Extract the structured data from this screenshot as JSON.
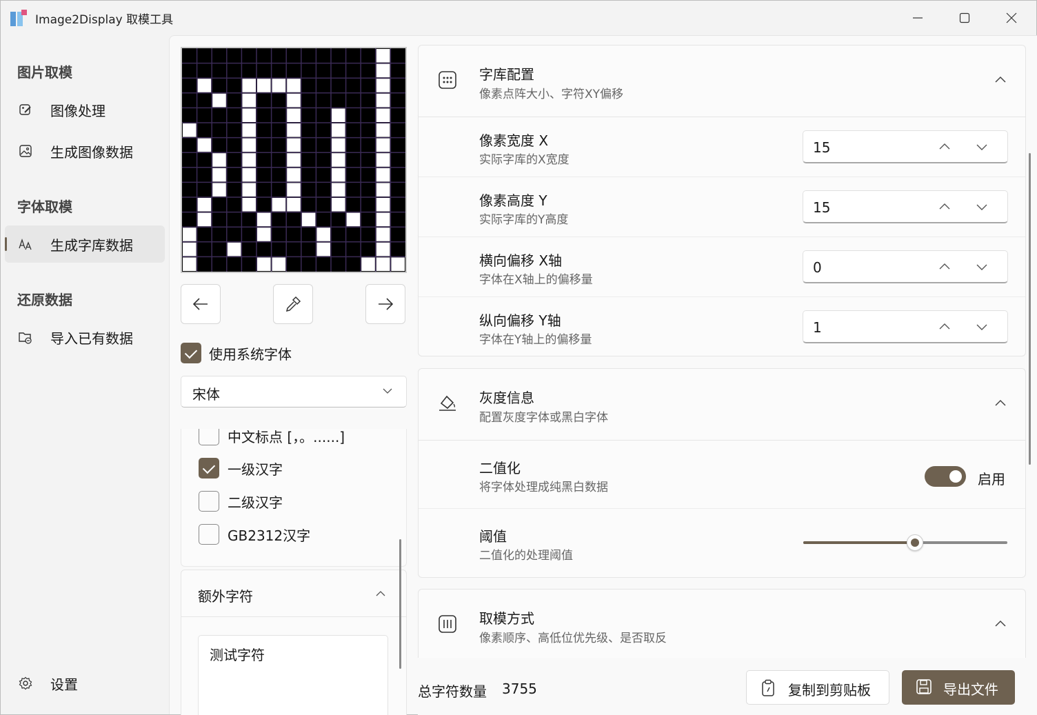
{
  "window": {
    "title": "Image2Display 取模工具"
  },
  "sidebar": {
    "groups": [
      {
        "label": "图片取模",
        "items": [
          {
            "label": "图像处理",
            "icon": "image-edit-icon"
          },
          {
            "label": "生成图像数据",
            "icon": "image-icon"
          }
        ]
      },
      {
        "label": "字体取模",
        "items": [
          {
            "label": "生成字库数据",
            "icon": "font-icon"
          }
        ]
      },
      {
        "label": "还原数据",
        "items": [
          {
            "label": "导入已有数据",
            "icon": "folder-image-icon"
          }
        ]
      }
    ],
    "settings": {
      "label": "设置",
      "icon": "gear-icon"
    }
  },
  "font_panel": {
    "use_system_font": {
      "label": "使用系统字体",
      "checked": true
    },
    "font_select": {
      "value": "宋体"
    },
    "charsets": [
      {
        "label": "中文标点 [，。......]",
        "checked": false
      },
      {
        "label": "一级汉字",
        "checked": true
      },
      {
        "label": "二级汉字",
        "checked": false
      },
      {
        "label": "GB2312汉字",
        "checked": false
      }
    ],
    "extra": {
      "title": "额外字符",
      "value": "测试字符"
    }
  },
  "cards": {
    "font_config": {
      "title": "字库配置",
      "subtitle": "像素点阵大小、字符XY偏移",
      "rows": [
        {
          "title": "像素宽度 X",
          "subtitle": "实际字库的X宽度",
          "value": "15"
        },
        {
          "title": "像素高度 Y",
          "subtitle": "实际字库的Y高度",
          "value": "15"
        },
        {
          "title": "横向偏移 X轴",
          "subtitle": "字体在X轴上的偏移量",
          "value": "0"
        },
        {
          "title": "纵向偏移 Y轴",
          "subtitle": "字体在Y轴上的偏移量",
          "value": "1"
        }
      ]
    },
    "gray": {
      "title": "灰度信息",
      "subtitle": "配置灰度字体或黑白字体",
      "binarize": {
        "title": "二值化",
        "subtitle": "将字体处理成纯黑白数据",
        "state": "启用",
        "on": true
      },
      "threshold": {
        "title": "阈值",
        "subtitle": "二值化的处理阈值",
        "level": 0.55
      }
    },
    "mode": {
      "title": "取模方式",
      "subtitle": "像素顺序、高低位优先级、是否取反"
    }
  },
  "footer": {
    "count_label": "总字符数量",
    "count_value": "3755",
    "copy_label": "复制到剪贴板",
    "export_label": "导出文件"
  },
  "colors": {
    "accent": "#6e6150",
    "preview_bg": "#000000",
    "pixel_on": "#ffffff",
    "grid": "#3a2a55"
  },
  "preview": {
    "grid": 15,
    "pixels": [
      "000000000000010",
      "000000000000010",
      "020022220000010",
      "002010010000010",
      "000010010010010",
      "100010010010010",
      "020010010010010",
      "001010010010010",
      "001010010010010",
      "001010010010010",
      "010010110010010",
      "010001001001010",
      "100001000100010",
      "100100000100010",
      "100001100000111"
    ]
  }
}
